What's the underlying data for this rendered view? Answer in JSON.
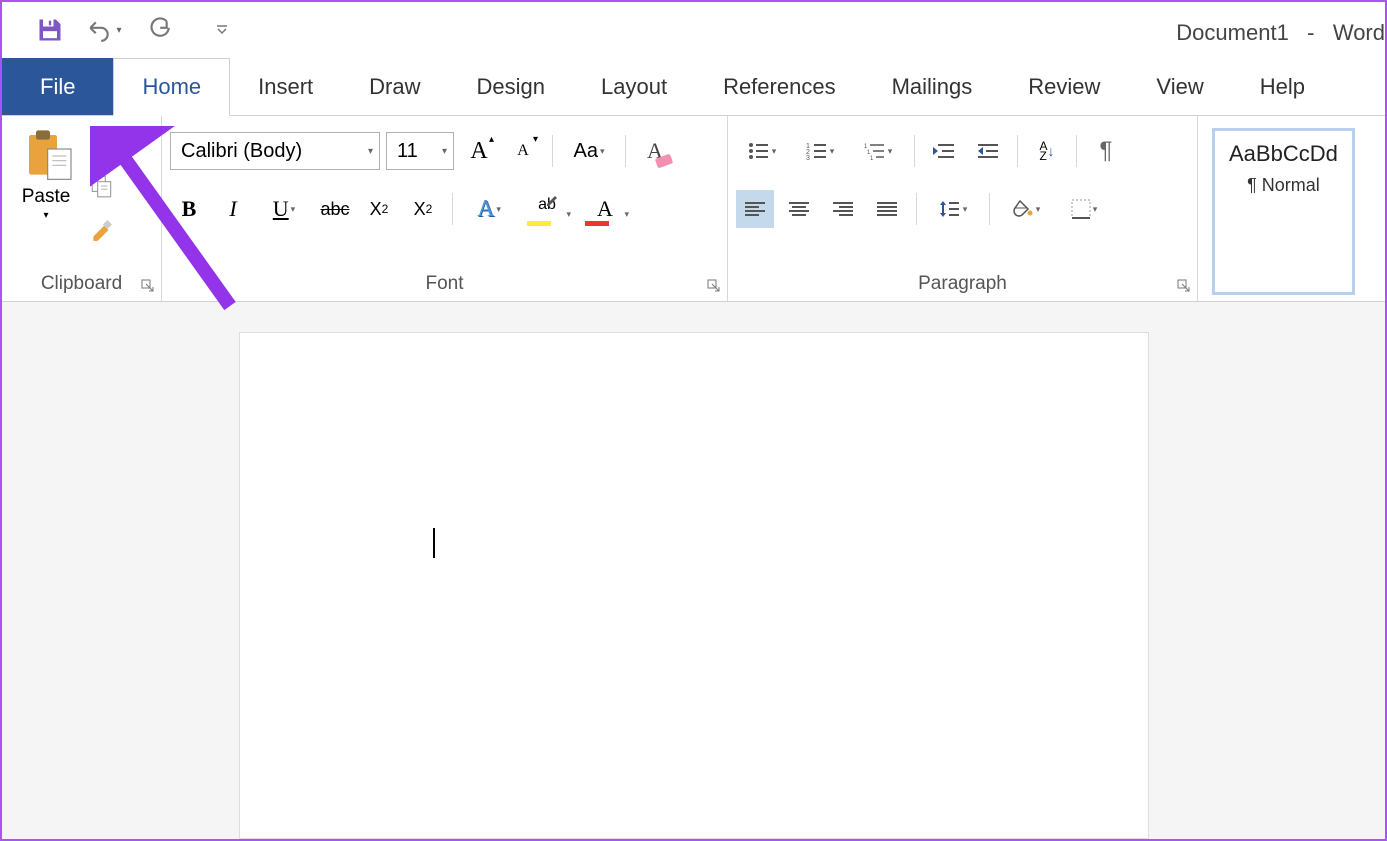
{
  "title": {
    "document": "Document1",
    "sep": "-",
    "app": "Word"
  },
  "tabs": {
    "file": "File",
    "home": "Home",
    "insert": "Insert",
    "draw": "Draw",
    "design": "Design",
    "layout": "Layout",
    "references": "References",
    "mailings": "Mailings",
    "review": "Review",
    "view": "View",
    "help": "Help"
  },
  "groups": {
    "clipboard": "Clipboard",
    "font": "Font",
    "paragraph": "Paragraph"
  },
  "clipboard": {
    "paste": "Paste"
  },
  "font": {
    "name": "Calibri (Body)",
    "size": "11",
    "grow": "A",
    "shrink": "A",
    "case": "Aa",
    "clear": "A",
    "bold": "B",
    "italic": "I",
    "underline": "U",
    "strike": "abc",
    "sub": "X",
    "sub2": "2",
    "sup": "X",
    "sup2": "2",
    "effects": "A",
    "highlight": "ab",
    "color": "A"
  },
  "paragraph": {
    "pilcrow": "¶",
    "sort": "A",
    "sortZ": "Z"
  },
  "styles": {
    "preview": "AaBbCcDd",
    "name": "¶ Normal"
  }
}
